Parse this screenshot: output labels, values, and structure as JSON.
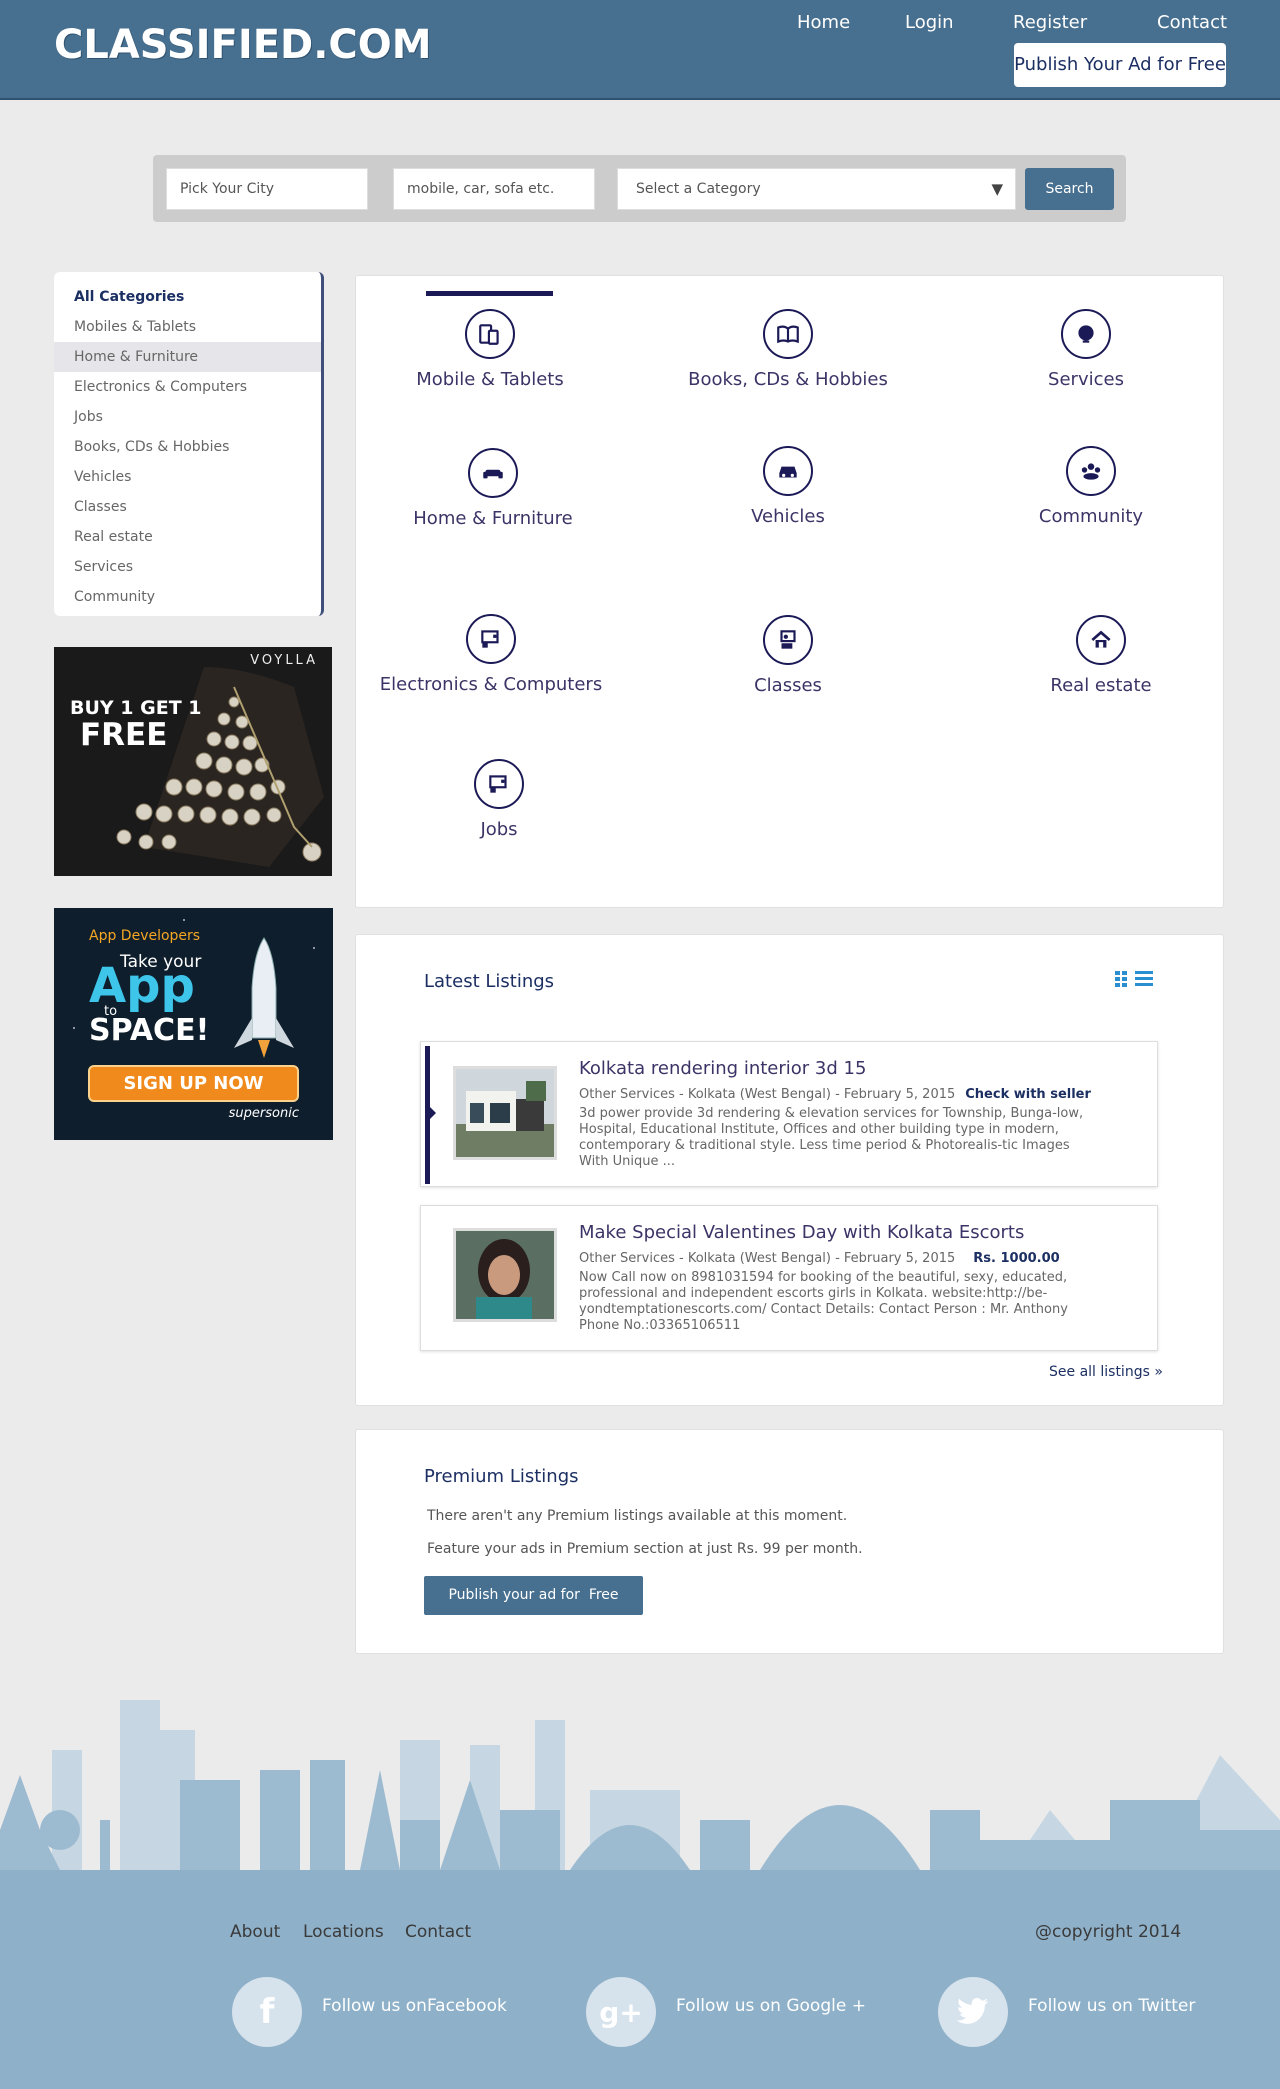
{
  "header": {
    "logo": "CLASSIFIED.COM",
    "nav": [
      "Home",
      "Login",
      "Register",
      "Contact"
    ],
    "publish_button": "Publish Your Ad for Free"
  },
  "search": {
    "city_placeholder": "Pick Your City",
    "keyword_placeholder": "mobile, car, sofa etc.",
    "category_select": "Select a Category",
    "button": "Search"
  },
  "sidebar": {
    "items": [
      {
        "label": "All Categories"
      },
      {
        "label": "Mobiles & Tablets"
      },
      {
        "label": "Home & Furniture"
      },
      {
        "label": "Electronics & Computers"
      },
      {
        "label": "Jobs"
      },
      {
        "label": "Books, CDs & Hobbies"
      },
      {
        "label": "Vehicles"
      },
      {
        "label": "Classes"
      },
      {
        "label": "Real estate"
      },
      {
        "label": "Services"
      },
      {
        "label": "Community"
      }
    ]
  },
  "ads": {
    "ad1": {
      "brand": "VOYLLA",
      "line1": "BUY 1 GET 1",
      "line2": "FREE"
    },
    "ad2": {
      "kicker": "App Developers",
      "line1": "Take your",
      "line2": "App",
      "line3": "to",
      "line4": "SPACE!",
      "cta": "SIGN UP NOW",
      "brand": "supersonic"
    }
  },
  "categories": [
    {
      "label": "Mobile & Tablets",
      "icon": "mobile-tablet-icon"
    },
    {
      "label": "Books, CDs & Hobbies",
      "icon": "book-icon"
    },
    {
      "label": "Services",
      "icon": "headset-icon"
    },
    {
      "label": "Home & Furniture",
      "icon": "sofa-icon"
    },
    {
      "label": "Vehicles",
      "icon": "car-icon"
    },
    {
      "label": "Community",
      "icon": "group-icon"
    },
    {
      "label": "Electronics & Computers",
      "icon": "computer-icon"
    },
    {
      "label": "Classes",
      "icon": "classroom-icon"
    },
    {
      "label": "Real estate",
      "icon": "house-icon"
    },
    {
      "label": "Jobs",
      "icon": "computer-icon"
    }
  ],
  "latest": {
    "title": "Latest Listings",
    "listings": [
      {
        "title": "Kolkata rendering interior 3d 15",
        "meta": "Other Services - Kolkata (West Bengal) - February 5, 2015",
        "extra": "Check with seller",
        "desc": "3d power provide 3d rendering & elevation services for Township, Bunga-low, Hospital, Educational Institute, Offices and other building type in modern, contemporary & traditional style. Less time period & Photorealis-tic Images With Unique ..."
      },
      {
        "title": "Make Special Valentines Day with Kolkata Escorts",
        "meta": "Other Services - Kolkata (West Bengal) - February 5, 2015",
        "extra": "Rs. 1000.00",
        "desc": "Now Call now on 8981031594 for booking of the beautiful, sexy, educated, professional and independent escorts girls in Kolkata. website:http://be-yondtemptationescorts.com/ Contact Details: Contact Person : Mr. Anthony Phone No.:03365106511"
      }
    ],
    "see_all": "See all listings »"
  },
  "premium": {
    "title": "Premium Listings",
    "line1": "There aren't any Premium listings available at this moment.",
    "line2": "Feature your ads in Premium section at just Rs. 99 per month.",
    "button": "Publish your ad for  Free"
  },
  "footer": {
    "links": [
      "About",
      "Locations",
      "Contact"
    ],
    "copyright": "@copyright 2014",
    "social": [
      {
        "label": "Follow us onFacebook",
        "icon": "facebook-icon",
        "glyph": "f"
      },
      {
        "label": "Follow us on Google +",
        "icon": "google-plus-icon",
        "glyph": "g+"
      },
      {
        "label": "Follow us on Twitter",
        "icon": "twitter-icon",
        "glyph": ""
      }
    ]
  },
  "colors": {
    "brand": "#476f8f",
    "accent": "#1c2f63",
    "footer": "#8eb0c9"
  }
}
